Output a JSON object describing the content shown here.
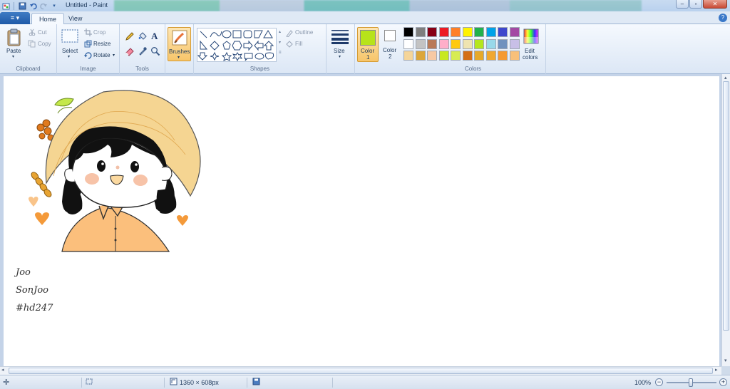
{
  "window": {
    "title": "Untitled - Paint",
    "controls": {
      "minimize": "–",
      "maximize": "▫",
      "close": "✕"
    }
  },
  "quick_access": [
    "save-icon",
    "undo-icon",
    "redo-icon",
    "customize-dropdown-icon"
  ],
  "menu": {
    "file_icon": "≡ ▾",
    "tabs": [
      {
        "label": "Home",
        "active": true
      },
      {
        "label": "View",
        "active": false
      }
    ],
    "help": "?"
  },
  "ribbon": {
    "clipboard": {
      "paste": "Paste",
      "cut": "Cut",
      "copy": "Copy",
      "label": "Clipboard"
    },
    "image": {
      "select": "Select",
      "crop": "Crop",
      "resize": "Resize",
      "rotate": "Rotate",
      "label": "Image"
    },
    "tools": {
      "label": "Tools"
    },
    "brushes": {
      "label": "Brushes"
    },
    "shapes": {
      "outline": "Outline",
      "fill": "Fill",
      "label": "Shapes"
    },
    "size": {
      "label": "Size"
    },
    "color1": {
      "label": "Color",
      "sub": "1",
      "color": "#b7e31a"
    },
    "color2": {
      "label": "Color",
      "sub": "2",
      "color": "#ffffff"
    },
    "colors": {
      "label": "Colors",
      "row1": [
        "#000000",
        "#7f7f7f",
        "#880015",
        "#ed1c24",
        "#ff7f27",
        "#fff200",
        "#22b14c",
        "#00a2e8",
        "#3f48cc",
        "#a349a4"
      ],
      "row2": [
        "#ffffff",
        "#c3c3c3",
        "#b97a57",
        "#ffaec9",
        "#ffc90e",
        "#efe4b0",
        "#b5e61d",
        "#99d9ea",
        "#7092be",
        "#c8bfe7"
      ],
      "row3": [
        "#f5d59a",
        "#dca63a",
        "#f7c9a3",
        "#c8e81f",
        "#d7ec52",
        "#d46f17",
        "#e6a92a",
        "#f0a830",
        "#f59a32",
        "#f8c07a"
      ]
    },
    "edit_colors": {
      "line1": "Edit",
      "line2": "colors"
    }
  },
  "canvas": {
    "signature_lines": [
      "Joo",
      "SonJoo",
      "#hd247"
    ]
  },
  "status": {
    "dimensions": "1360 × 608px",
    "zoom": "100%",
    "zoom_level": 1.0
  }
}
